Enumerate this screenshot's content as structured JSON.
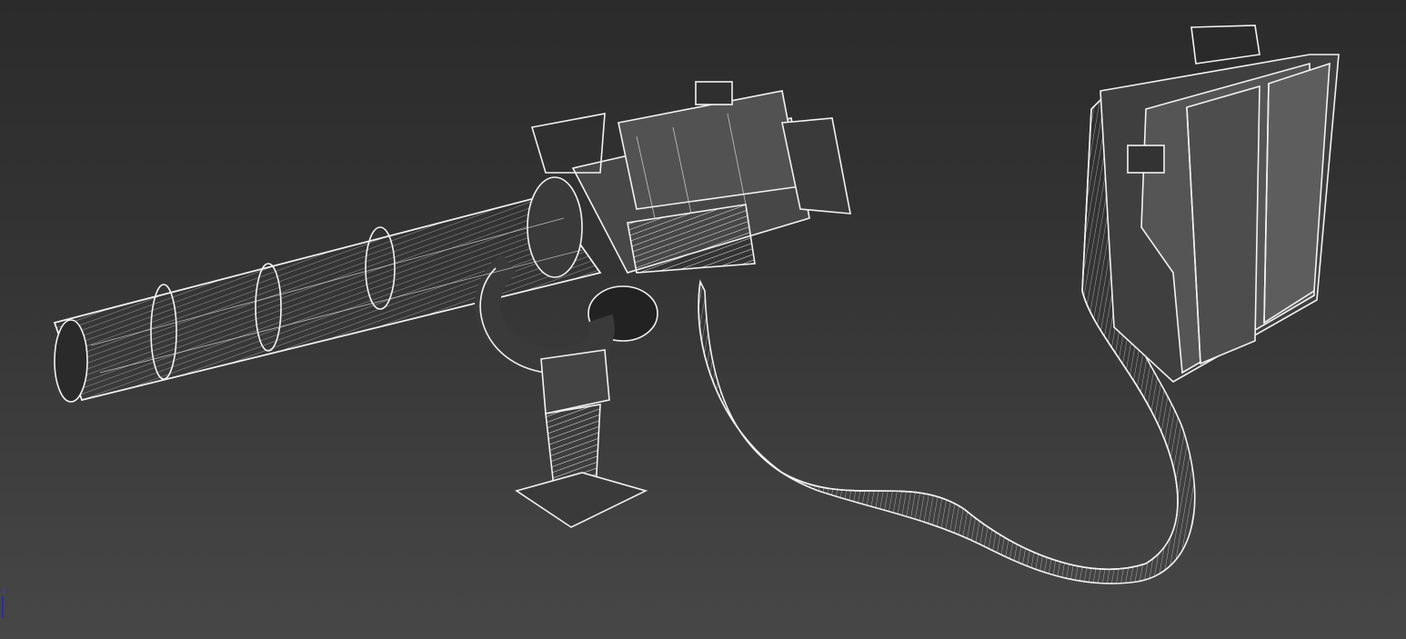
{
  "viewport": {
    "mode": "wireframe-over-shaded",
    "subject": "minigun model"
  },
  "gizmo": {
    "axis_label": "z",
    "axis_color": "#2c2ca8"
  },
  "colors": {
    "wire": "#f2f2f2",
    "shade": "#5a5a5a",
    "dark": "#1e1e1e"
  }
}
